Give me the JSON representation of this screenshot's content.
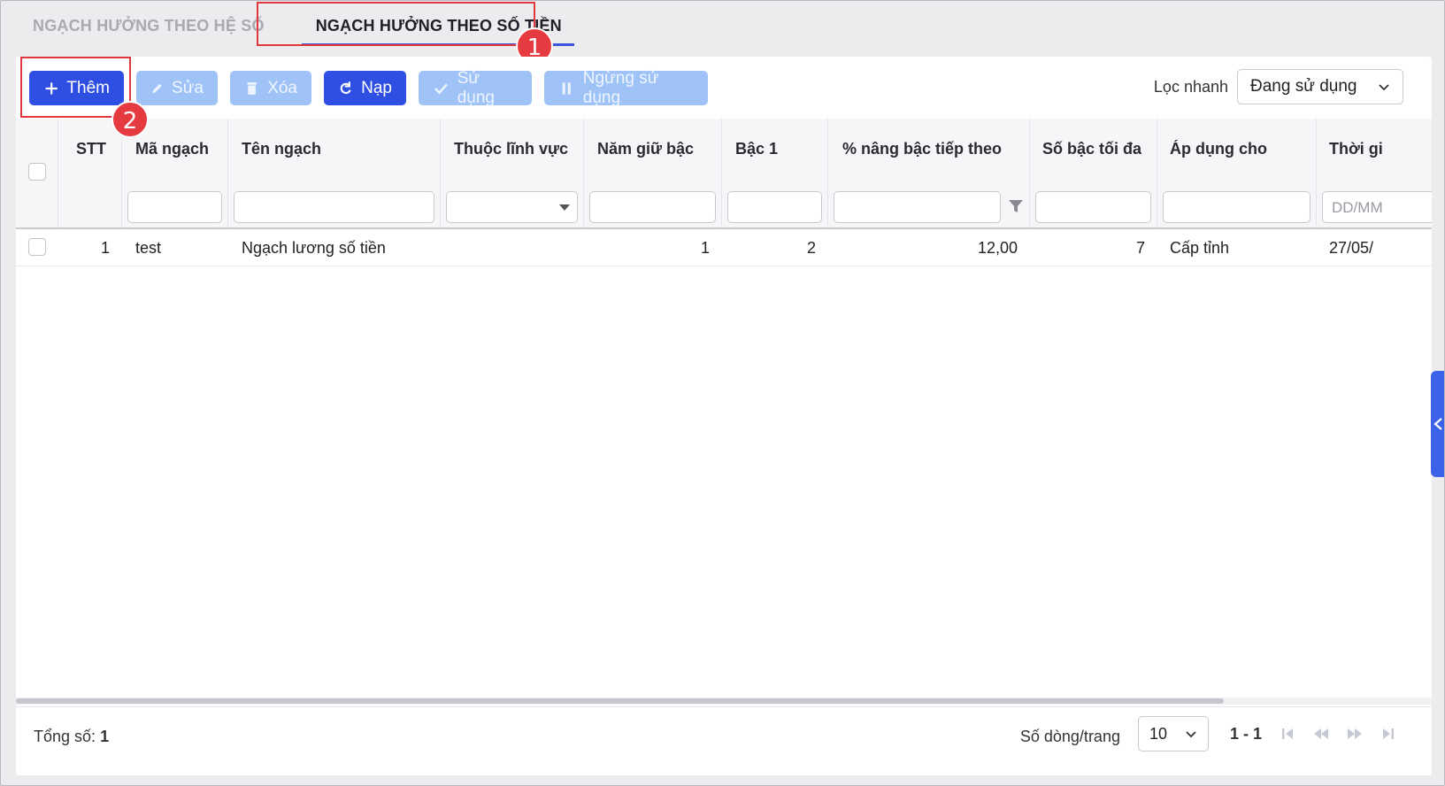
{
  "tabs": [
    {
      "label": "NGẠCH HƯỞNG THEO HỆ SỐ",
      "active": false
    },
    {
      "label": "NGẠCH HƯỞNG THEO SỐ TIỀN",
      "active": true
    }
  ],
  "annotations": {
    "badge1": "1",
    "badge2": "2",
    "color": "#e53a40"
  },
  "toolbar": {
    "add": "Thêm",
    "edit": "Sửa",
    "delete": "Xóa",
    "reload": "Nạp",
    "use": "Sử dụng",
    "stop_use": "Ngừng sử dụng"
  },
  "quick_filter": {
    "label": "Lọc nhanh",
    "value": "Đang sử dụng"
  },
  "table": {
    "columns": {
      "stt": "STT",
      "code": "Mã ngạch",
      "name": "Tên ngạch",
      "field": "Thuộc lĩnh vực",
      "years": "Năm giữ bậc",
      "level1": "Bậc 1",
      "percent": "% nâng bậc tiếp theo",
      "max_level": "Số bậc tối đa",
      "apply": "Áp dụng cho",
      "time": "Thời gi"
    },
    "date_placeholder": "DD/MM",
    "rows": [
      {
        "stt": "1",
        "code": "test",
        "name": "Ngạch lương số tiền",
        "field": "",
        "years": "1",
        "level1": "2",
        "percent": "12,00",
        "max_level": "7",
        "apply": "Cấp tỉnh",
        "time": "27/05/"
      }
    ]
  },
  "footer": {
    "total_label": "Tổng số:",
    "total_value": "1",
    "rows_per_page_label": "Số dòng/trang",
    "rows_per_page": "10",
    "range": "1 - 1"
  },
  "colors": {
    "primary": "#2f4fe3",
    "disabled": "#9fc3f7",
    "accent": "#3d56d9"
  }
}
